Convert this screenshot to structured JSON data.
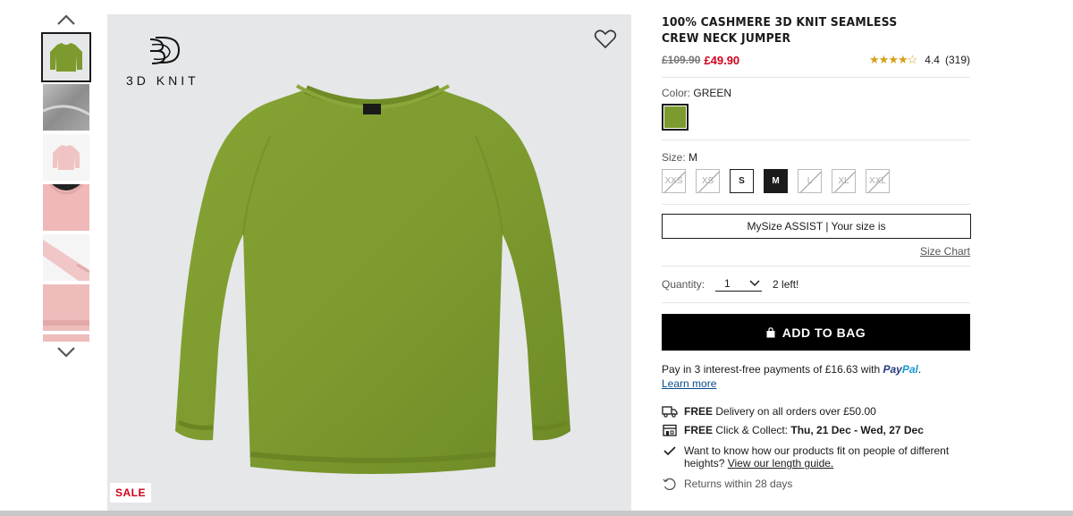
{
  "thumbnails": {
    "scroll_up_icon": "chevron-up-icon",
    "scroll_down_icon": "chevron-down-icon",
    "items": [
      {
        "color": "#7c9a2e",
        "kind": "sweater"
      },
      {
        "color": "#9a9a9a",
        "kind": "texture"
      },
      {
        "color": "#f0c4c4",
        "kind": "sweater-small"
      },
      {
        "color": "#efb9b9",
        "kind": "neck"
      },
      {
        "color": "#f1c6c6",
        "kind": "sleeve"
      },
      {
        "color": "#efbcbc",
        "kind": "hem"
      },
      {
        "color": "#efbcbc",
        "kind": "partial"
      }
    ]
  },
  "main_image": {
    "badge_text": "3D KNIT",
    "sale_badge": "SALE",
    "sweater_color": "#7c9a2e",
    "wishlist_icon": "heart-icon"
  },
  "product": {
    "title": "100% CASHMERE 3D KNIT SEAMLESS CREW NECK JUMPER",
    "old_price": "£109.90",
    "new_price": "£49.90",
    "stars": "★★★★☆",
    "rating": "4.4",
    "review_count": "(319)"
  },
  "color": {
    "label": "Color:",
    "value": "GREEN",
    "swatch": "#7c9a2e"
  },
  "size": {
    "label": "Size:",
    "value": "M",
    "options": [
      "XXS",
      "XS",
      "S",
      "M",
      "L",
      "XL",
      "XXL"
    ]
  },
  "mysize": {
    "label": "MySize ASSIST | Your size is"
  },
  "size_chart": "Size Chart",
  "quantity": {
    "label": "Quantity:",
    "value": "1",
    "stock": "2 left!"
  },
  "add_to_bag": "ADD TO BAG",
  "paypal": {
    "text": "Pay in 3 interest-free payments of £16.63 with",
    "brand_a": "Pay",
    "brand_b": "Pal",
    "period": ".",
    "learn_more": "Learn more"
  },
  "delivery": {
    "free": "FREE",
    "delivery_text": "Delivery on all orders over £50.00",
    "collect_text": "Click & Collect:",
    "collect_dates": "Thu, 21 Dec - Wed, 27 Dec"
  },
  "fit": {
    "text": "Want to know how our products fit on people of different heights?",
    "link": "View our length guide."
  },
  "returns": "Returns within 28 days",
  "colors": {
    "sale_red": "#d0021b",
    "accent": "#000000"
  }
}
